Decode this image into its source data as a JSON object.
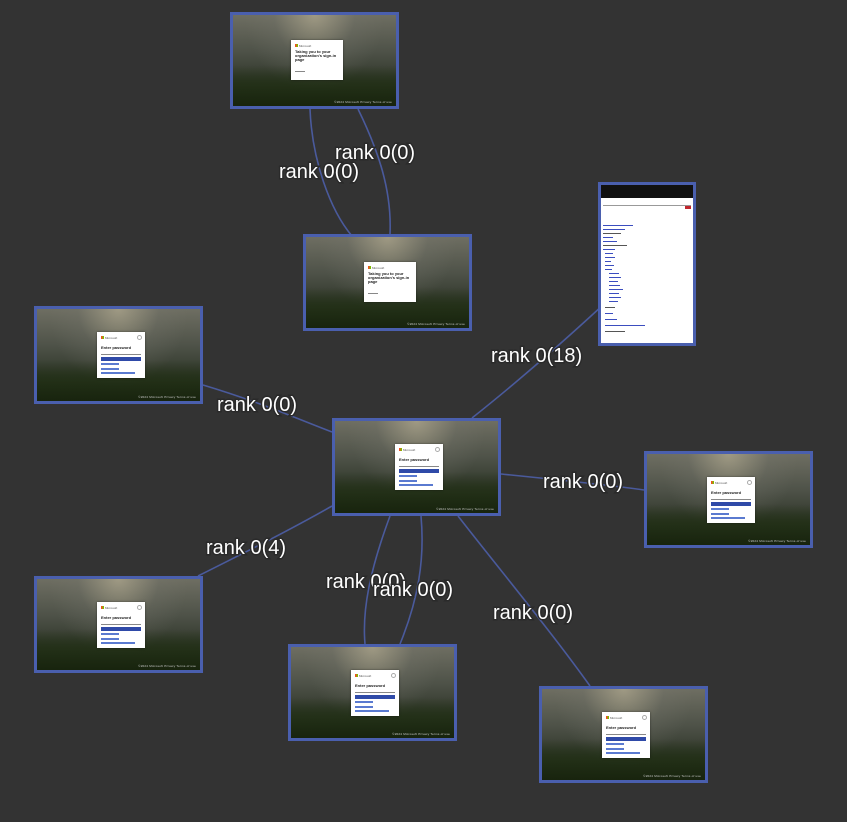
{
  "nodes": [
    {
      "id": "n1",
      "kind": "message",
      "message_lines": [
        "Taking you to your",
        "organization's sign-in",
        "page"
      ],
      "footer": "©2024 Microsoft  Privacy  Terms of use"
    },
    {
      "id": "n2",
      "kind": "message",
      "message_lines": [
        "Taking you to your",
        "organization's sign-in",
        "page"
      ],
      "footer": "©2024 Microsoft  Privacy  Terms of use"
    },
    {
      "id": "n3",
      "kind": "webpage"
    },
    {
      "id": "n4",
      "kind": "signin",
      "title": "Enter password",
      "footer": "©2024 Microsoft  Privacy  Terms of use"
    },
    {
      "id": "n5",
      "kind": "signin",
      "title": "Enter password",
      "footer": "©2024 Microsoft  Privacy  Terms of use"
    },
    {
      "id": "n6",
      "kind": "signin",
      "title": "Enter password",
      "footer": "©2024 Microsoft  Privacy  Terms of use"
    },
    {
      "id": "n7",
      "kind": "signin",
      "title": "Enter password",
      "footer": "©2024 Microsoft  Privacy  Terms of use"
    },
    {
      "id": "n8",
      "kind": "signin",
      "title": "Enter password",
      "footer": "©2024 Microsoft  Privacy  Terms of use"
    },
    {
      "id": "n9",
      "kind": "signin",
      "title": "Enter password",
      "footer": "©2024 Microsoft  Privacy  Terms of use"
    }
  ],
  "edges": [
    {
      "from": "n1",
      "to": "n2",
      "label": "rank 0(0)"
    },
    {
      "from": "n2",
      "to": "n1",
      "label": "rank 0(0)"
    },
    {
      "from": "n5",
      "to": "n3",
      "label": "rank 0(18)"
    },
    {
      "from": "n4",
      "to": "n5",
      "label": "rank 0(0)"
    },
    {
      "from": "n5",
      "to": "n6",
      "label": "rank 0(0)"
    },
    {
      "from": "n5",
      "to": "n7",
      "label": "rank 0(4)"
    },
    {
      "from": "n5",
      "to": "n8",
      "label": "rank 0(0)"
    },
    {
      "from": "n8",
      "to": "n5",
      "label": "rank 0(0)"
    },
    {
      "from": "n5",
      "to": "n9",
      "label": "rank 0(0)"
    }
  ],
  "brand_label": "Microsoft",
  "colors": {
    "background": "#333333",
    "edge": "#4a5a9c",
    "node_border": "#4a5fae",
    "label_text": "#ffffff"
  }
}
